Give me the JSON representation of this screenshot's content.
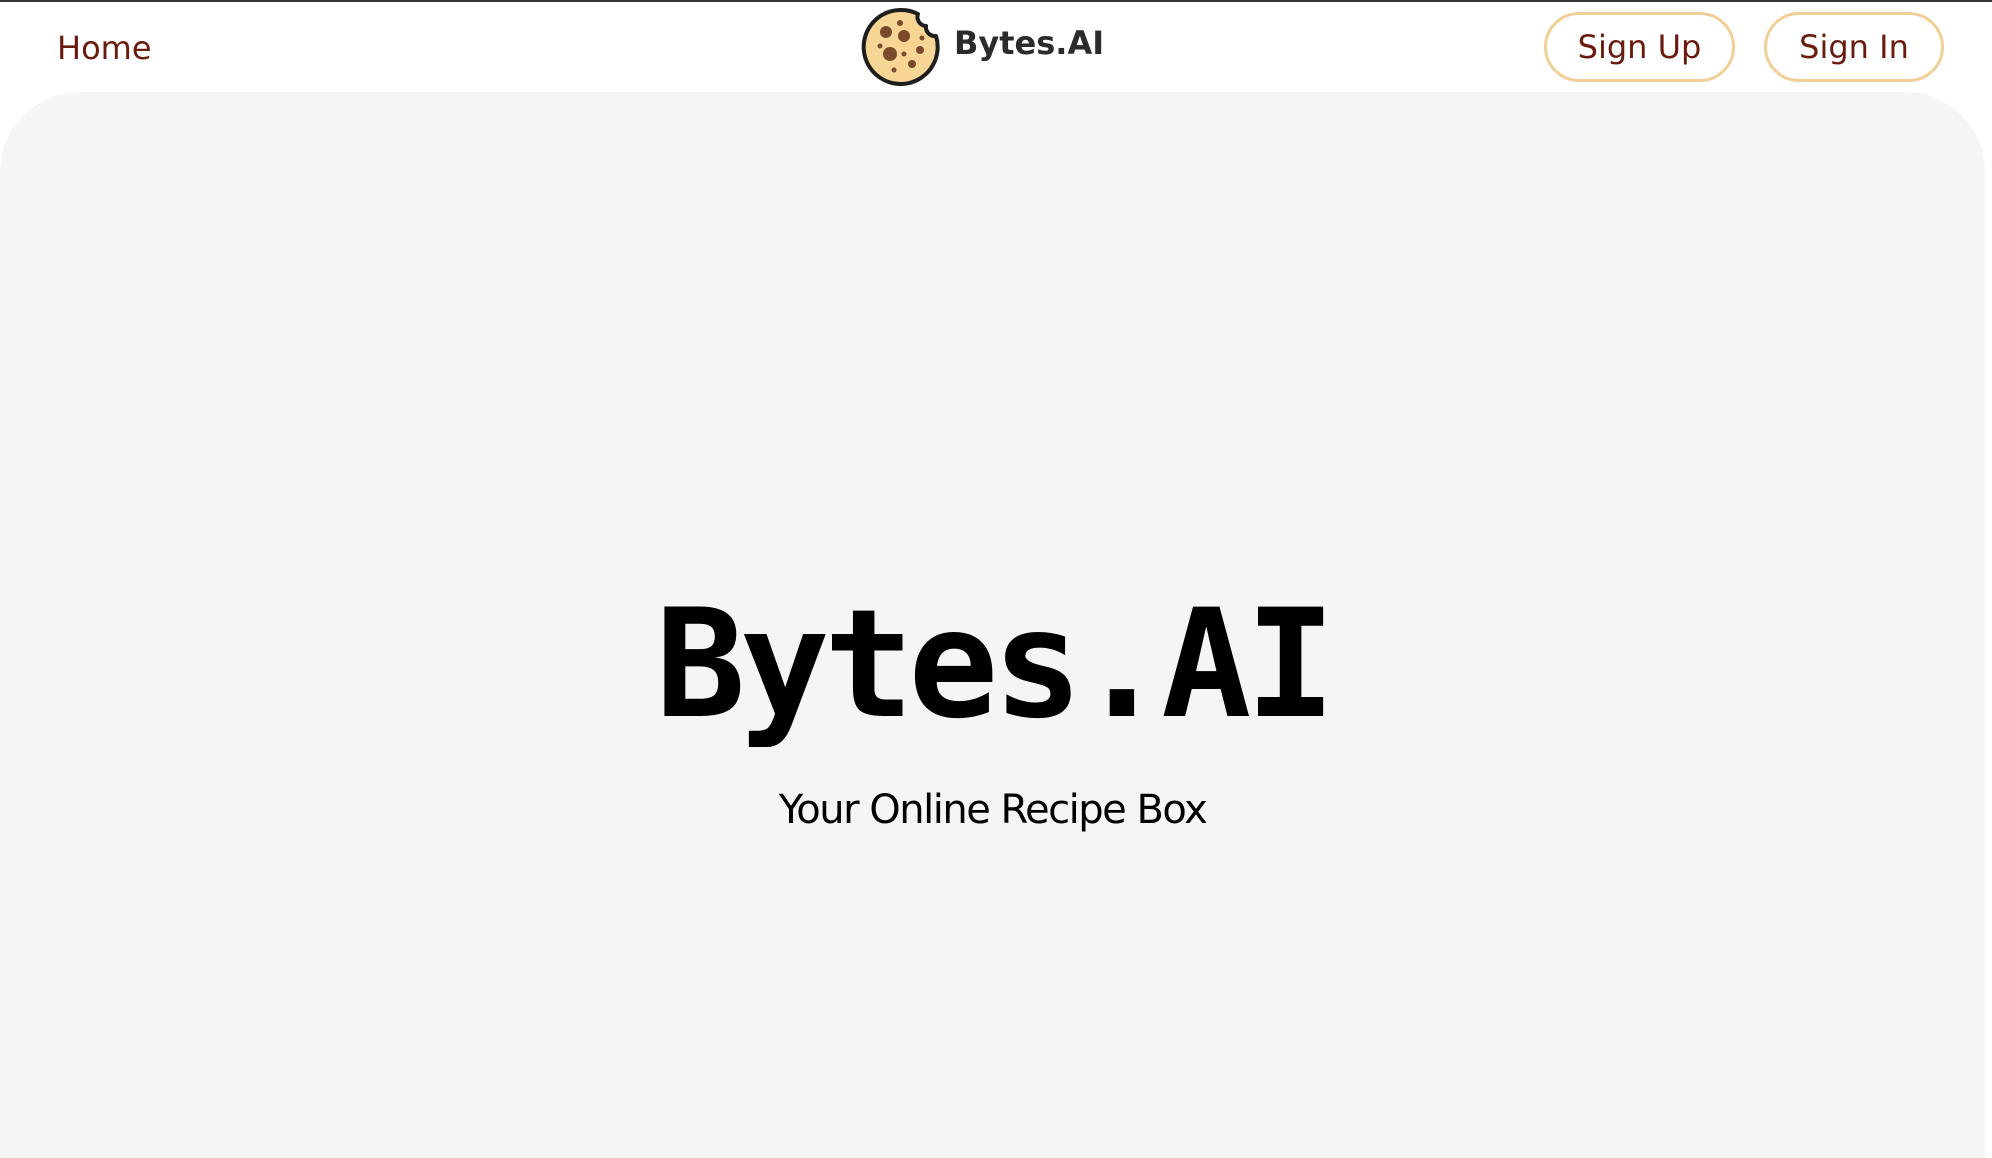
{
  "nav": {
    "home_label": "Home",
    "brand_name": "Bytes.AI",
    "logo_icon": "cookie-icon",
    "sign_up_label": "Sign Up",
    "sign_in_label": "Sign In"
  },
  "hero": {
    "title": "Bytes.AI",
    "subtitle": "Your Online Recipe Box"
  },
  "colors": {
    "link": "#6b1a0e",
    "button_border": "#f2cf96",
    "hero_background": "#f5f5f5",
    "cookie_fill": "#f7d594",
    "cookie_chips": "#7a4a2c"
  }
}
